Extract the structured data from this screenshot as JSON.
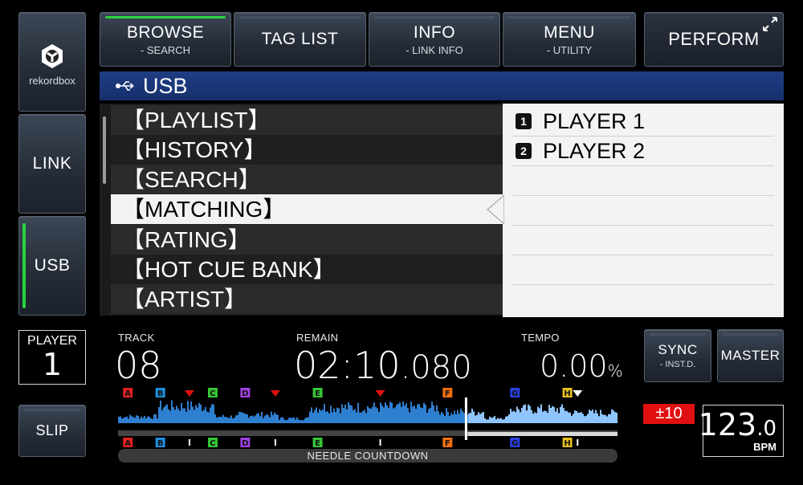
{
  "sidebar": {
    "rekordbox_label": "rekordbox",
    "link_label": "LINK",
    "usb_label": "USB"
  },
  "topnav": {
    "browse": {
      "label": "BROWSE",
      "sub": "- SEARCH"
    },
    "taglist": {
      "label": "TAG LIST"
    },
    "info": {
      "label": "INFO",
      "sub": "- LINK INFO"
    },
    "menu": {
      "label": "MENU",
      "sub": "- UTILITY"
    },
    "perform": {
      "label": "PERFORM"
    }
  },
  "path": {
    "label": "USB"
  },
  "browse_list": [
    "【PLAYLIST】",
    "【HISTORY】",
    "【SEARCH】",
    "【MATCHING】",
    "【RATING】",
    "【HOT CUE BANK】",
    "【ARTIST】"
  ],
  "selected_index": 3,
  "players": [
    {
      "num": "1",
      "label": "PLAYER 1"
    },
    {
      "num": "2",
      "label": "PLAYER 2"
    }
  ],
  "deck": {
    "player_label": "PLAYER",
    "player_num": "1",
    "slip_label": "SLIP",
    "track_label": "TRACK",
    "track_value": "08",
    "remain_label": "REMAIN",
    "remain_main": "02",
    "remain_sep": ":",
    "remain_sec": "10",
    "remain_ms": ".080",
    "tempo_label": "TEMPO",
    "tempo_value": "0.00",
    "tempo_unit": "%",
    "sync_label": "SYNC",
    "sync_sub": "- INST.D.",
    "master_label": "MASTER",
    "tempo_range": "±10",
    "bpm_int": "123",
    "bpm_dec": ".0",
    "bpm_unit": "BPM",
    "needle_label": "NEEDLE COUNTDOWN"
  },
  "hot_cues": [
    {
      "letter": "A",
      "color": "#e02020",
      "pos": 0.01
    },
    {
      "letter": "B",
      "color": "#1e8fe0",
      "pos": 0.075
    },
    {
      "letter": "C",
      "color": "#36c636",
      "pos": 0.18
    },
    {
      "letter": "D",
      "color": "#a040e0",
      "pos": 0.245
    },
    {
      "letter": "E",
      "color": "#36c636",
      "pos": 0.39
    },
    {
      "letter": "F",
      "color": "#f07010",
      "pos": 0.65
    },
    {
      "letter": "G",
      "color": "#2a40e0",
      "pos": 0.785
    },
    {
      "letter": "H",
      "color": "#e8c020",
      "pos": 0.89
    }
  ],
  "memory_cues": [
    0.143,
    0.315,
    0.525,
    0.92
  ],
  "playback_position": 0.7,
  "colors": {
    "accent_green": "#29d33d",
    "path_blue": "#1f3d84",
    "waveform_blue": "#2f7fd0",
    "tempo_red": "#e01010"
  }
}
